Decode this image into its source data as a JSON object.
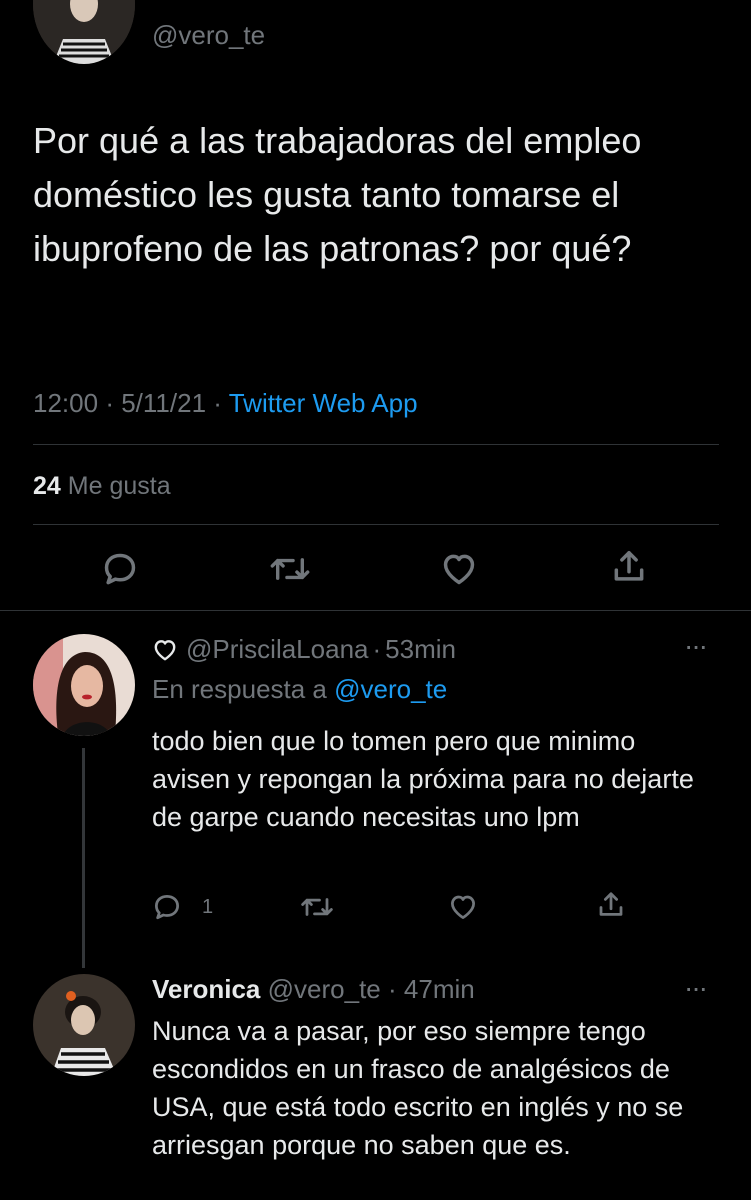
{
  "main_tweet": {
    "handle": "@vero_te",
    "text": "Por qué a las trabajadoras del empleo doméstico les gusta tanto tomarse el ibuprofeno de las patronas? por qué?",
    "time": "12:00",
    "sep1": "·",
    "date": "5/11/21",
    "sep2": "·",
    "source": "Twitter Web App",
    "likes_count": "24",
    "likes_label": "Me gusta"
  },
  "replies": [
    {
      "handle": "@PriscilaLoana",
      "sep": "·",
      "time": "53min",
      "reply_prefix": "En respuesta a",
      "reply_to": "@vero_te",
      "text": "todo bien que lo tomen pero que minimo avisen y repongan la próxima para no dejarte de garpe cuando necesitas uno lpm",
      "reply_count": "1",
      "more": "···"
    },
    {
      "name": "Veronica",
      "handle": "@vero_te",
      "sep": "·",
      "time": "47min",
      "text": "Nunca va a pasar, por eso siempre tengo escondidos en un frasco de analgésicos de USA, que está todo escrito en inglés y no se arriesgan porque no saben que es.",
      "more": "···"
    }
  ],
  "colors": {
    "background": "#000000",
    "text": "#e7e9ea",
    "muted": "#71767b",
    "accent": "#1d9bf0",
    "divider": "#2f3336"
  },
  "icons": [
    "reply-icon",
    "retweet-icon",
    "like-icon",
    "share-icon",
    "more-icon",
    "heart-outline-icon"
  ]
}
